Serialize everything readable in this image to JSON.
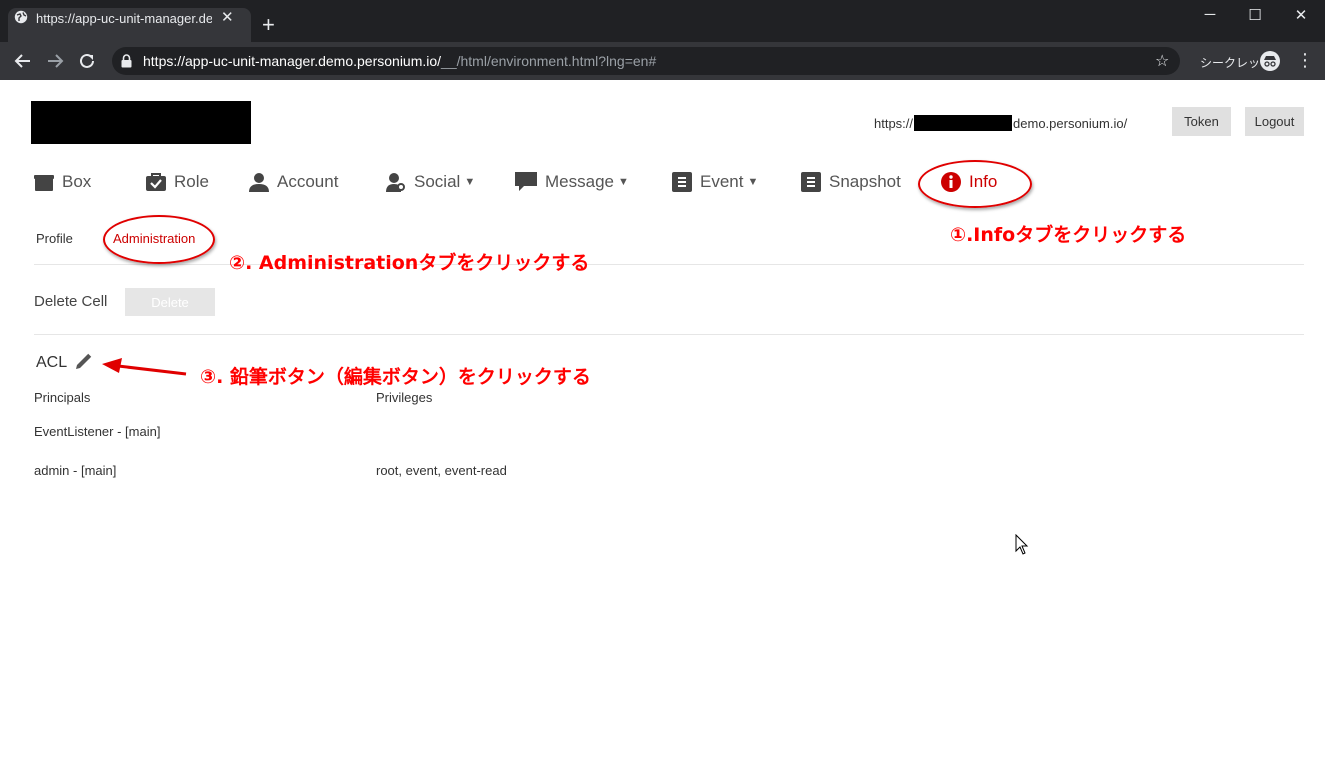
{
  "browser": {
    "tab_title": "https://app-uc-unit-manager.dem",
    "new_tab_icon": "+",
    "url_main": "https://app-uc-unit-manager.demo.personium.io/",
    "url_rest": "__/html/environment.html?lng=en#",
    "incognito_label": "シークレット"
  },
  "header": {
    "endpoint_prefix": "https://",
    "endpoint_suffix": "demo.personium.io/",
    "token_label": "Token",
    "logout_label": "Logout"
  },
  "nav": {
    "box": "Box",
    "role": "Role",
    "account": "Account",
    "social": "Social",
    "message": "Message",
    "event": "Event",
    "snapshot": "Snapshot",
    "info": "Info"
  },
  "subtabs": {
    "profile": "Profile",
    "administration": "Administration"
  },
  "admin": {
    "delete_cell_label": "Delete Cell",
    "delete_button": "Delete"
  },
  "acl": {
    "title": "ACL",
    "columns": [
      "Principals",
      "Privileges"
    ],
    "rows": [
      {
        "principal": "EventListener - [main]",
        "privileges": ""
      },
      {
        "principal": "admin - [main]",
        "privileges": "root, event, event-read"
      }
    ]
  },
  "annotations": {
    "step1": "①.Infoタブをクリックする",
    "step2": "②. Administrationタブをクリックする",
    "step3": "③. 鉛筆ボタン（編集ボタン）をクリックする"
  },
  "colors": {
    "accent": "#cc0000",
    "annotation": "#ff0000",
    "chrome_dark": "#202124",
    "chrome_toolbar": "#35363a"
  }
}
